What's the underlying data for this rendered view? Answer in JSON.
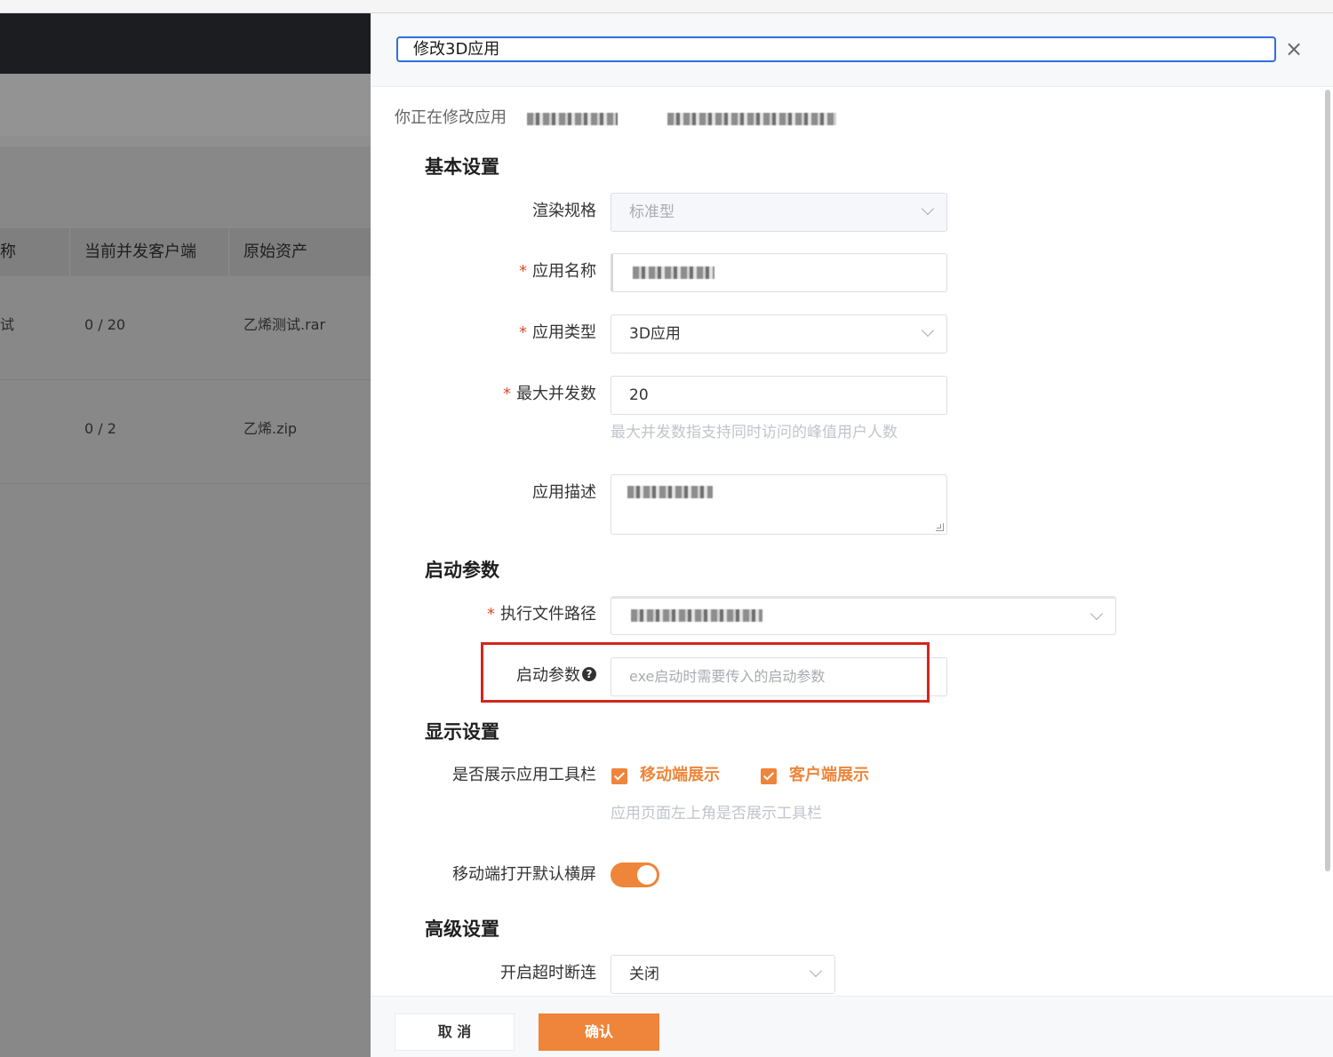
{
  "background": {
    "table_headers": [
      "称",
      "当前并发客户端",
      "原始资产"
    ],
    "rows": [
      {
        "name": "试",
        "concurrency": "0 / 20",
        "asset": "乙烯测试.rar"
      },
      {
        "name": "",
        "concurrency": "0 / 2",
        "asset": "乙烯.zip"
      }
    ]
  },
  "drawer": {
    "title": "修改3D应用",
    "close_icon": "×",
    "modifying_prefix": "你正在修改应用",
    "sections": {
      "basic": "基本设置",
      "launch": "启动参数",
      "display": "显示设置",
      "advanced": "高级设置"
    },
    "fields": {
      "render_spec": {
        "label": "渲染规格",
        "value": "标准型"
      },
      "app_name": {
        "label": "应用名称",
        "required": "*"
      },
      "app_type": {
        "label": "应用类型",
        "required": "*",
        "value": "3D应用"
      },
      "max_concurrency": {
        "label": "最大并发数",
        "required": "*",
        "value": "20",
        "hint": "最大并发数指支持同时访问的峰值用户人数"
      },
      "app_desc": {
        "label": "应用描述"
      },
      "exe_path": {
        "label": "执行文件路径",
        "required": "*"
      },
      "launch_params": {
        "label": "启动参数",
        "help": "?",
        "placeholder": "exe启动时需要传入的启动参数"
      },
      "toolbar": {
        "label": "是否展示应用工具栏",
        "mobile": "移动端展示",
        "client": "客户端展示",
        "hint": "应用页面左上角是否展示工具栏"
      },
      "landscape": {
        "label": "移动端打开默认横屏",
        "enabled": true
      },
      "timeout": {
        "label": "开启超时断连",
        "value": "关闭"
      }
    },
    "footer": {
      "cancel": "取 消",
      "confirm": "确认"
    }
  },
  "colors": {
    "accent": "#ee853a",
    "highlight_box": "#d3261d",
    "focus": "#2f6fdd"
  }
}
